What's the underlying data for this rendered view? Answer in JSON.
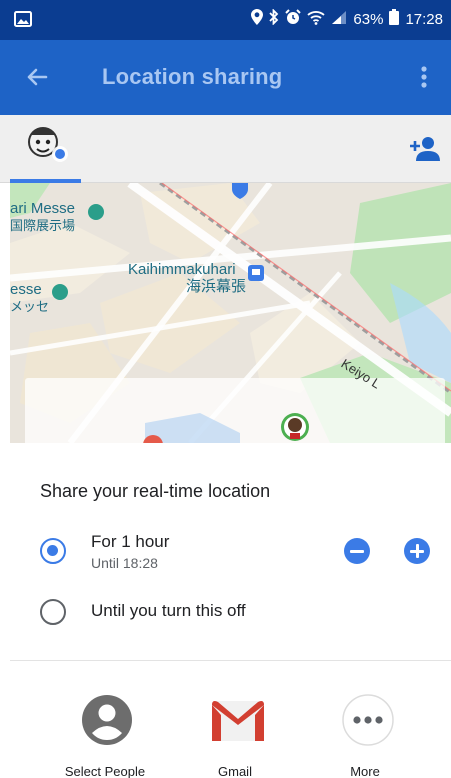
{
  "status_bar": {
    "battery_percent": "63%",
    "time": "17:28"
  },
  "app_bar": {
    "title": "Location sharing"
  },
  "map": {
    "labels": {
      "messe_left_top": "ari Messe",
      "messe_left_top_jp": "国際展示場",
      "station_en": "Kaihimmakuhari",
      "station_jp": "海浜幕張",
      "messe_left_bottom": "esse",
      "messe_left_bottom_jp": "メッセ",
      "line_name": "Keiyo L"
    }
  },
  "sheet": {
    "heading": "Share your real-time location",
    "option_hour": {
      "label": "For 1 hour",
      "sub": "Until 18:28"
    },
    "option_off": {
      "label": "Until you turn this off"
    },
    "share_apps": [
      {
        "label": "Select People",
        "icon": "person-icon"
      },
      {
        "label": "Gmail",
        "icon": "gmail-icon"
      },
      {
        "label": "More",
        "icon": "more-horizontal-icon"
      }
    ]
  },
  "colors": {
    "status_bar": "#0b3d91",
    "app_bar": "#1e63c6",
    "accent": "#3b7be6"
  }
}
